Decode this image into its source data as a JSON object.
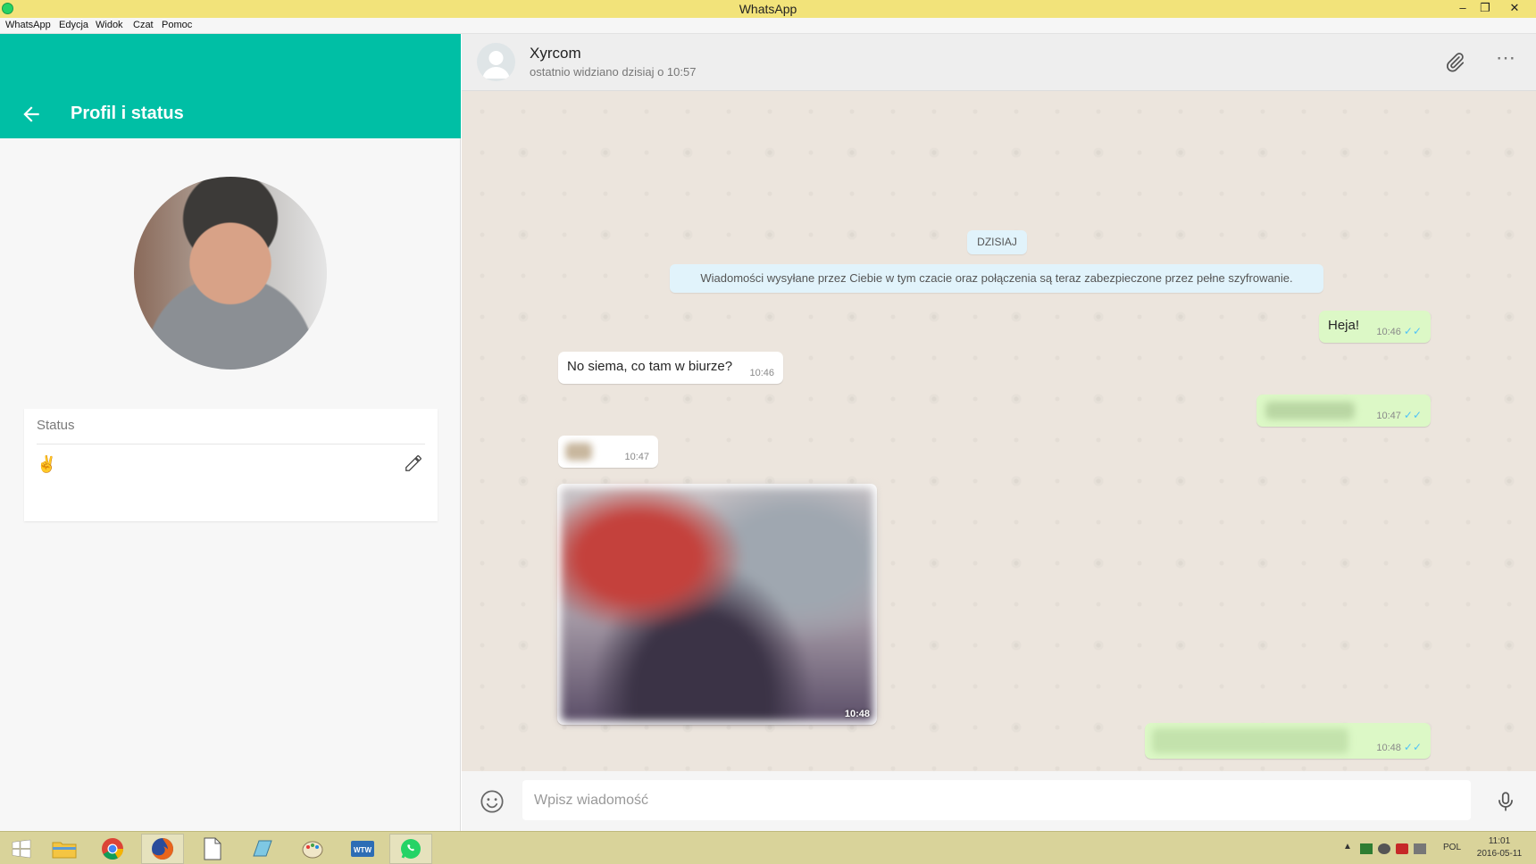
{
  "window": {
    "title": "WhatsApp"
  },
  "menu": [
    "WhatsApp",
    "Edycja",
    "Widok",
    "Czat",
    "Pomoc"
  ],
  "profile": {
    "header_title": "Profil i status",
    "status_label": "Status",
    "status_value": "✌"
  },
  "chat": {
    "contact_name": "Xyrcom",
    "contact_status": "ostatnio widziano dzisiaj o 10:57",
    "date_label": "DZISIAJ",
    "encryption_notice": "Wiadomości wysyłane przez Ciebie w tym czacie oraz połączenia są teraz zabezpieczone przez pełne szyfrowanie.",
    "messages": [
      {
        "direction": "out",
        "text": "Heja!",
        "time": "10:46",
        "read": true
      },
      {
        "direction": "in",
        "text": "No siema, co tam w biurze?",
        "time": "10:46"
      },
      {
        "direction": "out",
        "text": "",
        "time": "10:47",
        "read": true,
        "blurred": true
      },
      {
        "direction": "in",
        "text": "",
        "time": "10:47",
        "blurred": true
      },
      {
        "direction": "in",
        "type": "image",
        "time": "10:48",
        "blurred": true
      },
      {
        "direction": "out",
        "text": "",
        "time": "10:48",
        "read": true,
        "blurred": true
      }
    ],
    "input_placeholder": "Wpisz wiadomość"
  },
  "taskbar": {
    "apps": [
      "start",
      "file-explorer",
      "chrome",
      "firefox",
      "document",
      "notepad",
      "paint",
      "wtw",
      "whatsapp"
    ],
    "active_app": "whatsapp",
    "language": "POL",
    "time": "11:01",
    "date": "2016-05-11"
  },
  "colors": {
    "accent": "#00bfa5",
    "outgoing_bubble": "#dcf8c6",
    "incoming_bubble": "#ffffff",
    "chat_background": "#ece5dd",
    "title_bar": "#f2e37a",
    "read_check": "#4fc3f7"
  }
}
